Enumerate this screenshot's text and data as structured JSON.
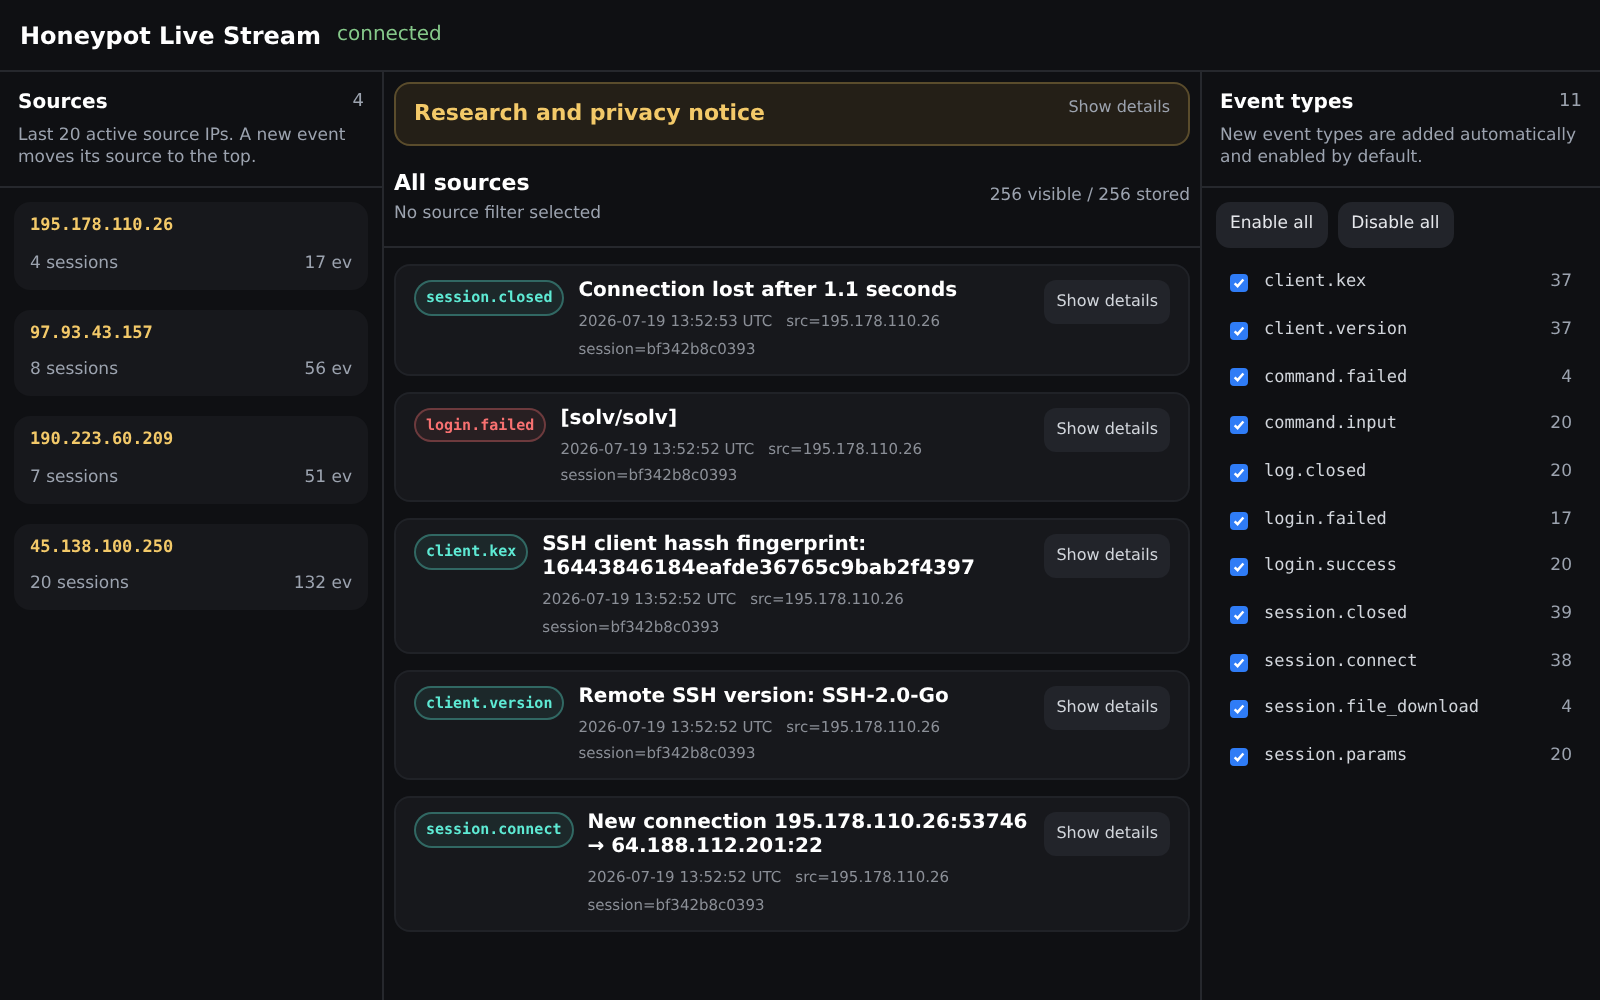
{
  "header": {
    "title": "Honeypot Live Stream",
    "status": "connected"
  },
  "sources": {
    "title": "Sources",
    "count": "4",
    "description": "Last 20 active source IPs. A new event moves its source to the top.",
    "items": [
      {
        "ip": "195.178.110.26",
        "sessions": "4 sessions",
        "events": "17 ev"
      },
      {
        "ip": "97.93.43.157",
        "sessions": "8 sessions",
        "events": "56 ev"
      },
      {
        "ip": "190.223.60.209",
        "sessions": "7 sessions",
        "events": "51 ev"
      },
      {
        "ip": "45.138.100.250",
        "sessions": "20 sessions",
        "events": "132 ev"
      }
    ]
  },
  "notice": {
    "title": "Research and privacy notice",
    "action": "Show details"
  },
  "stream": {
    "title": "All sources",
    "subtitle": "No source filter selected",
    "counts": "256 visible / 256 stored",
    "events": [
      {
        "tag": "session.closed",
        "color": "#5eead4",
        "title": "Connection lost after 1.1 seconds",
        "time": "2026-07-19 13:52:53 UTC",
        "src": "src=195.178.110.26",
        "session": "session=bf342b8c0393",
        "action": "Show details"
      },
      {
        "tag": "login.failed",
        "color": "#f87171",
        "title": "[solv/solv]",
        "time": "2026-07-19 13:52:52 UTC",
        "src": "src=195.178.110.26",
        "session": "session=bf342b8c0393",
        "action": "Show details"
      },
      {
        "tag": "client.kex",
        "color": "#5eead4",
        "title": "SSH client hassh fingerprint: 16443846184eafde36765c9bab2f4397",
        "time": "2026-07-19 13:52:52 UTC",
        "src": "src=195.178.110.26",
        "session": "session=bf342b8c0393",
        "action": "Show details"
      },
      {
        "tag": "client.version",
        "color": "#5eead4",
        "title": "Remote SSH version: SSH-2.0-Go",
        "time": "2026-07-19 13:52:52 UTC",
        "src": "src=195.178.110.26",
        "session": "session=bf342b8c0393",
        "action": "Show details"
      },
      {
        "tag": "session.connect",
        "color": "#5eead4",
        "title": "New connection 195.178.110.26:53746 → 64.188.112.201:22",
        "time": "2026-07-19 13:52:52 UTC",
        "src": "src=195.178.110.26",
        "session": "session=bf342b8c0393",
        "action": "Show details"
      }
    ]
  },
  "event_types": {
    "title": "Event types",
    "count": "11",
    "description": "New event types are added automatically and enabled by default.",
    "buttons": [
      "Enable all",
      "Disable all"
    ],
    "items": [
      {
        "name": "client.kex",
        "count": "37",
        "checked": true
      },
      {
        "name": "client.version",
        "count": "37",
        "checked": true
      },
      {
        "name": "command.failed",
        "count": "4",
        "checked": true
      },
      {
        "name": "command.input",
        "count": "20",
        "checked": true
      },
      {
        "name": "log.closed",
        "count": "20",
        "checked": true
      },
      {
        "name": "login.failed",
        "count": "17",
        "checked": true
      },
      {
        "name": "login.success",
        "count": "20",
        "checked": true
      },
      {
        "name": "session.closed",
        "count": "39",
        "checked": true
      },
      {
        "name": "session.connect",
        "count": "38",
        "checked": true
      },
      {
        "name": "session.file_download",
        "count": "4",
        "checked": true
      },
      {
        "name": "session.params",
        "count": "20",
        "checked": true
      }
    ]
  }
}
